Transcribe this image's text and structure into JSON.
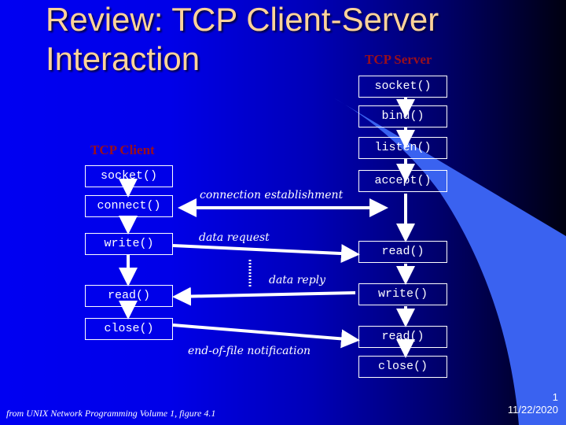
{
  "slide": {
    "title_line1": "Review: TCP Client-Server",
    "title_line2": "Interaction",
    "page_number": "1",
    "date": "11/22/2020",
    "footer": "from UNIX Network Programming Volume 1, figure 4.1"
  },
  "colors": {
    "title": "#ffd39a",
    "role_label": "#9a0f1c",
    "swoosh": "#3a62f0",
    "lines": "#ffffff"
  },
  "client": {
    "label": "TCP Client",
    "calls": [
      "socket()",
      "connect()",
      "write()",
      "read()",
      "close()"
    ]
  },
  "server": {
    "label": "TCP Server",
    "calls": [
      "socket()",
      "bind()",
      "listen()",
      "accept()",
      "read()",
      "write()",
      "read()",
      "close()"
    ]
  },
  "messages": {
    "connection": "connection establishment",
    "request": "data request",
    "reply": "data reply",
    "eof": "end-of-file notification"
  }
}
